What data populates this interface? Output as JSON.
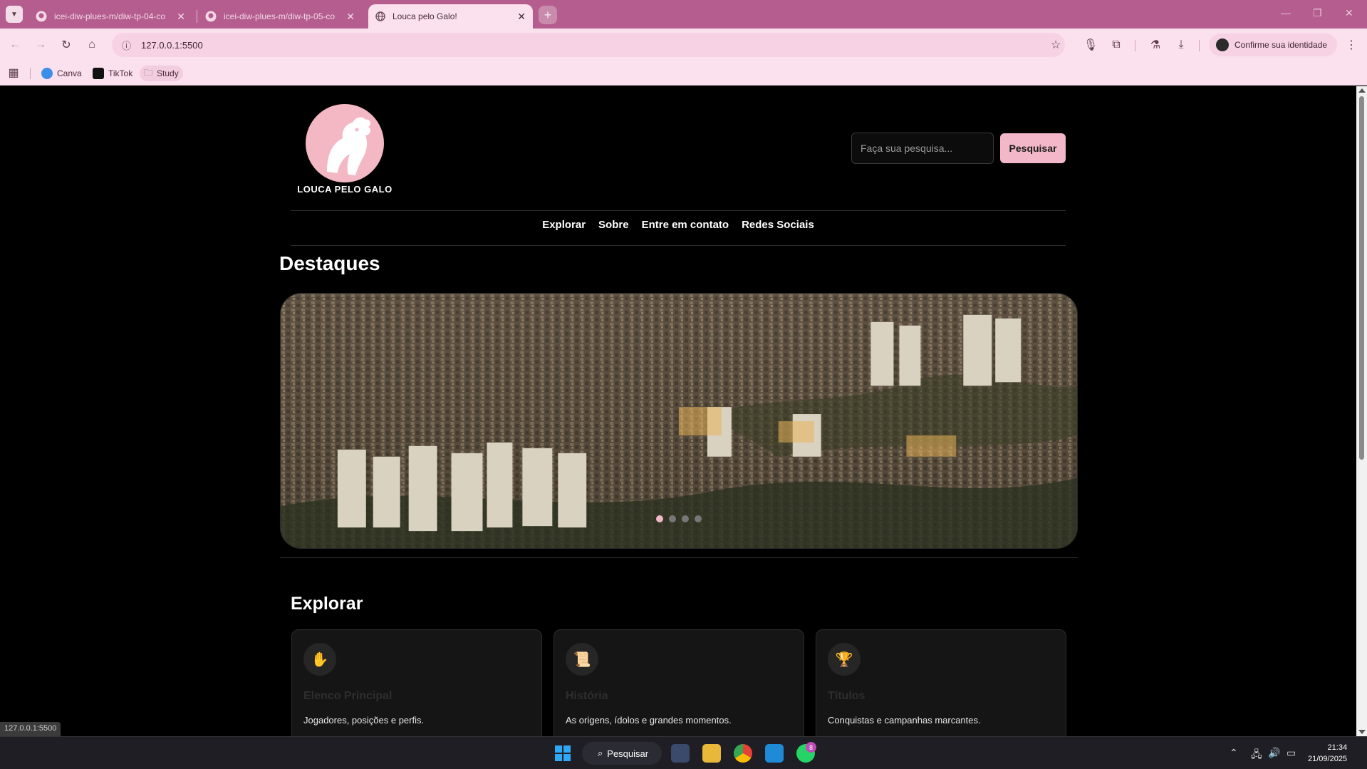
{
  "browser": {
    "tabs": [
      {
        "title": "icei-diw-plues-m/diw-tp-04-co",
        "icon": "github-icon",
        "active": false
      },
      {
        "title": "icei-diw-plues-m/diw-tp-05-co",
        "icon": "github-icon",
        "active": false
      },
      {
        "title": "Louca pelo Galo!",
        "icon": "globe-icon",
        "active": true
      }
    ],
    "new_tab_symbol": "+",
    "url": "127.0.0.1:5500",
    "profile_label": "Confirme sua identidade",
    "bookmarks": [
      {
        "label": "Canva",
        "icon": "canva-icon"
      },
      {
        "label": "TikTok",
        "icon": "tiktok-icon"
      },
      {
        "label": "Study",
        "icon": "folder-icon"
      }
    ],
    "status_url": "127.0.0.1:5500",
    "colors": {
      "tabbar": "#b45d8e",
      "toolbar": "#fbe0ee"
    }
  },
  "site": {
    "logo_text": "LOUCA PELO GALO",
    "search": {
      "placeholder": "Faça sua pesquisa...",
      "button_label": "Pesquisar"
    },
    "nav": [
      "Explorar",
      "Sobre",
      "Entre em contato",
      "Redes Sociais"
    ],
    "highlights_title": "Destaques",
    "carousel": {
      "slide_count": 4,
      "active_index": 0
    },
    "explore_title": "Explorar",
    "cards": [
      {
        "icon": "hand-icon",
        "glyph": "✋",
        "title": "Elenco Principal",
        "desc": "Jogadores, posições e perfis."
      },
      {
        "icon": "scroll-icon",
        "glyph": "📜",
        "title": "História",
        "desc": "As origens, ídolos e grandes momentos."
      },
      {
        "icon": "trophy-icon",
        "glyph": "🏆",
        "title": "Títulos",
        "desc": "Conquistas e campanhas marcantes."
      }
    ],
    "colors": {
      "accent": "#f2b8c9",
      "background": "#000000",
      "card": "#151515"
    }
  },
  "taskbar": {
    "search_label": "Pesquisar",
    "whatsapp_badge": "8",
    "time": "21:34",
    "date": "21/09/2025"
  }
}
